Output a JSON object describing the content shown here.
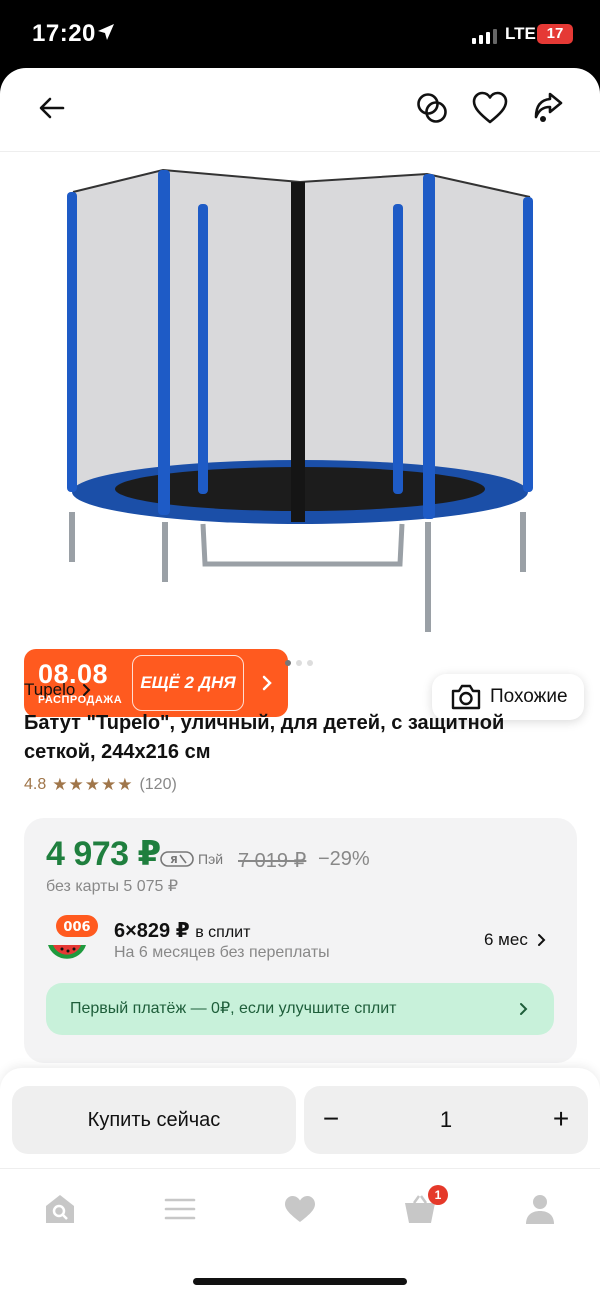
{
  "status_bar": {
    "time": "17:20",
    "network": "LTE",
    "battery": "17"
  },
  "header": {
    "back_icon": "arrow-left-icon",
    "compare_icon": "compare-rings-icon",
    "favorite_icon": "heart-icon",
    "share_icon": "share-icon"
  },
  "gallery": {
    "promo": {
      "date": "08.08",
      "subtitle": "РАСПРОДАЖА",
      "days_left": "ЕЩЁ 2 ДНЯ"
    },
    "similar_button": "Похожие",
    "active_dot": 1,
    "dot_count": 3
  },
  "product": {
    "brand": "Tupelo",
    "title": "Батут \"Tupelo\", уличный, для детей, с защитной сеткой, 244x216 см",
    "rating": "4.8",
    "stars": "★★★★★",
    "reviews": "(120)"
  },
  "price": {
    "current": "4 973 ₽",
    "pay_label": "Пэй",
    "old": "7 019 ₽",
    "discount": "−29%",
    "without_card": "без карты 5 075 ₽"
  },
  "split": {
    "logo_badge": "006",
    "amount": "6×829 ₽",
    "amount_suffix": "в сплит",
    "subtitle": "На 6 месяцев без переплаты",
    "term": "6 мес",
    "first_payment": "Первый платёж — 0₽, если улучшите сплит"
  },
  "purchase": {
    "buy_now": "Купить сейчас",
    "minus": "−",
    "quantity": "1",
    "plus": "+"
  },
  "tabbar": {
    "cart_badge": "1"
  },
  "colors": {
    "accent_green": "#1f7f3e",
    "promo_orange": "#ff5a1f",
    "split_bg": "#c8f1da",
    "badge_red": "#e5392a"
  }
}
